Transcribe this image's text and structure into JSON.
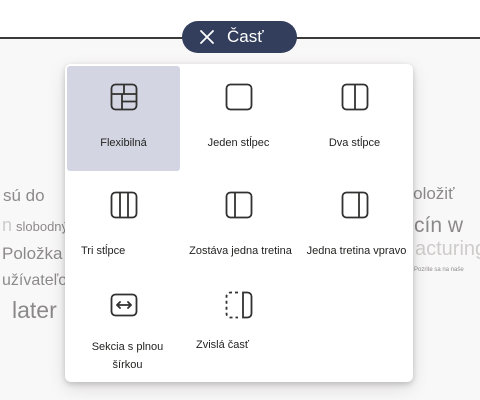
{
  "section_button": {
    "label": "Časť",
    "icon": "close-icon",
    "color": "#323e5c"
  },
  "background_text": {
    "line1_left": "sú do",
    "line1_right": ")položiť",
    "line2_left_faint": "n",
    "line2_left": "slobodný",
    "line2_right": "cín w",
    "line3_left": "Položka",
    "line3_right_faint": "acturing",
    "line3_right_small": "Pozrite sa na naše",
    "line4_left": "užívateľov t",
    "line5_left": "later"
  },
  "layout_options": [
    {
      "label": "Flexibilná",
      "icon": "flexible-layout-icon",
      "selected": true
    },
    {
      "label": "Jeden stĺpec",
      "icon": "one-column-icon",
      "selected": false
    },
    {
      "label": "Dva stĺpce",
      "icon": "two-columns-icon",
      "selected": false
    },
    {
      "label": "Tri stĺpce",
      "icon": "three-columns-icon",
      "selected": false
    },
    {
      "label": "Zostáva jedna tretina",
      "icon": "one-third-left-icon",
      "selected": false
    },
    {
      "label": "Jedna tretina vpravo",
      "icon": "one-third-right-icon",
      "selected": false
    },
    {
      "label": "Sekcia s plnou šírkou",
      "icon": "full-width-section-icon",
      "selected": false
    },
    {
      "label": "Zvislá časť",
      "icon": "vertical-section-icon",
      "selected": false
    }
  ],
  "colors": {
    "selected_bg": "#d3d6e2",
    "icon_stroke": "#323130"
  }
}
